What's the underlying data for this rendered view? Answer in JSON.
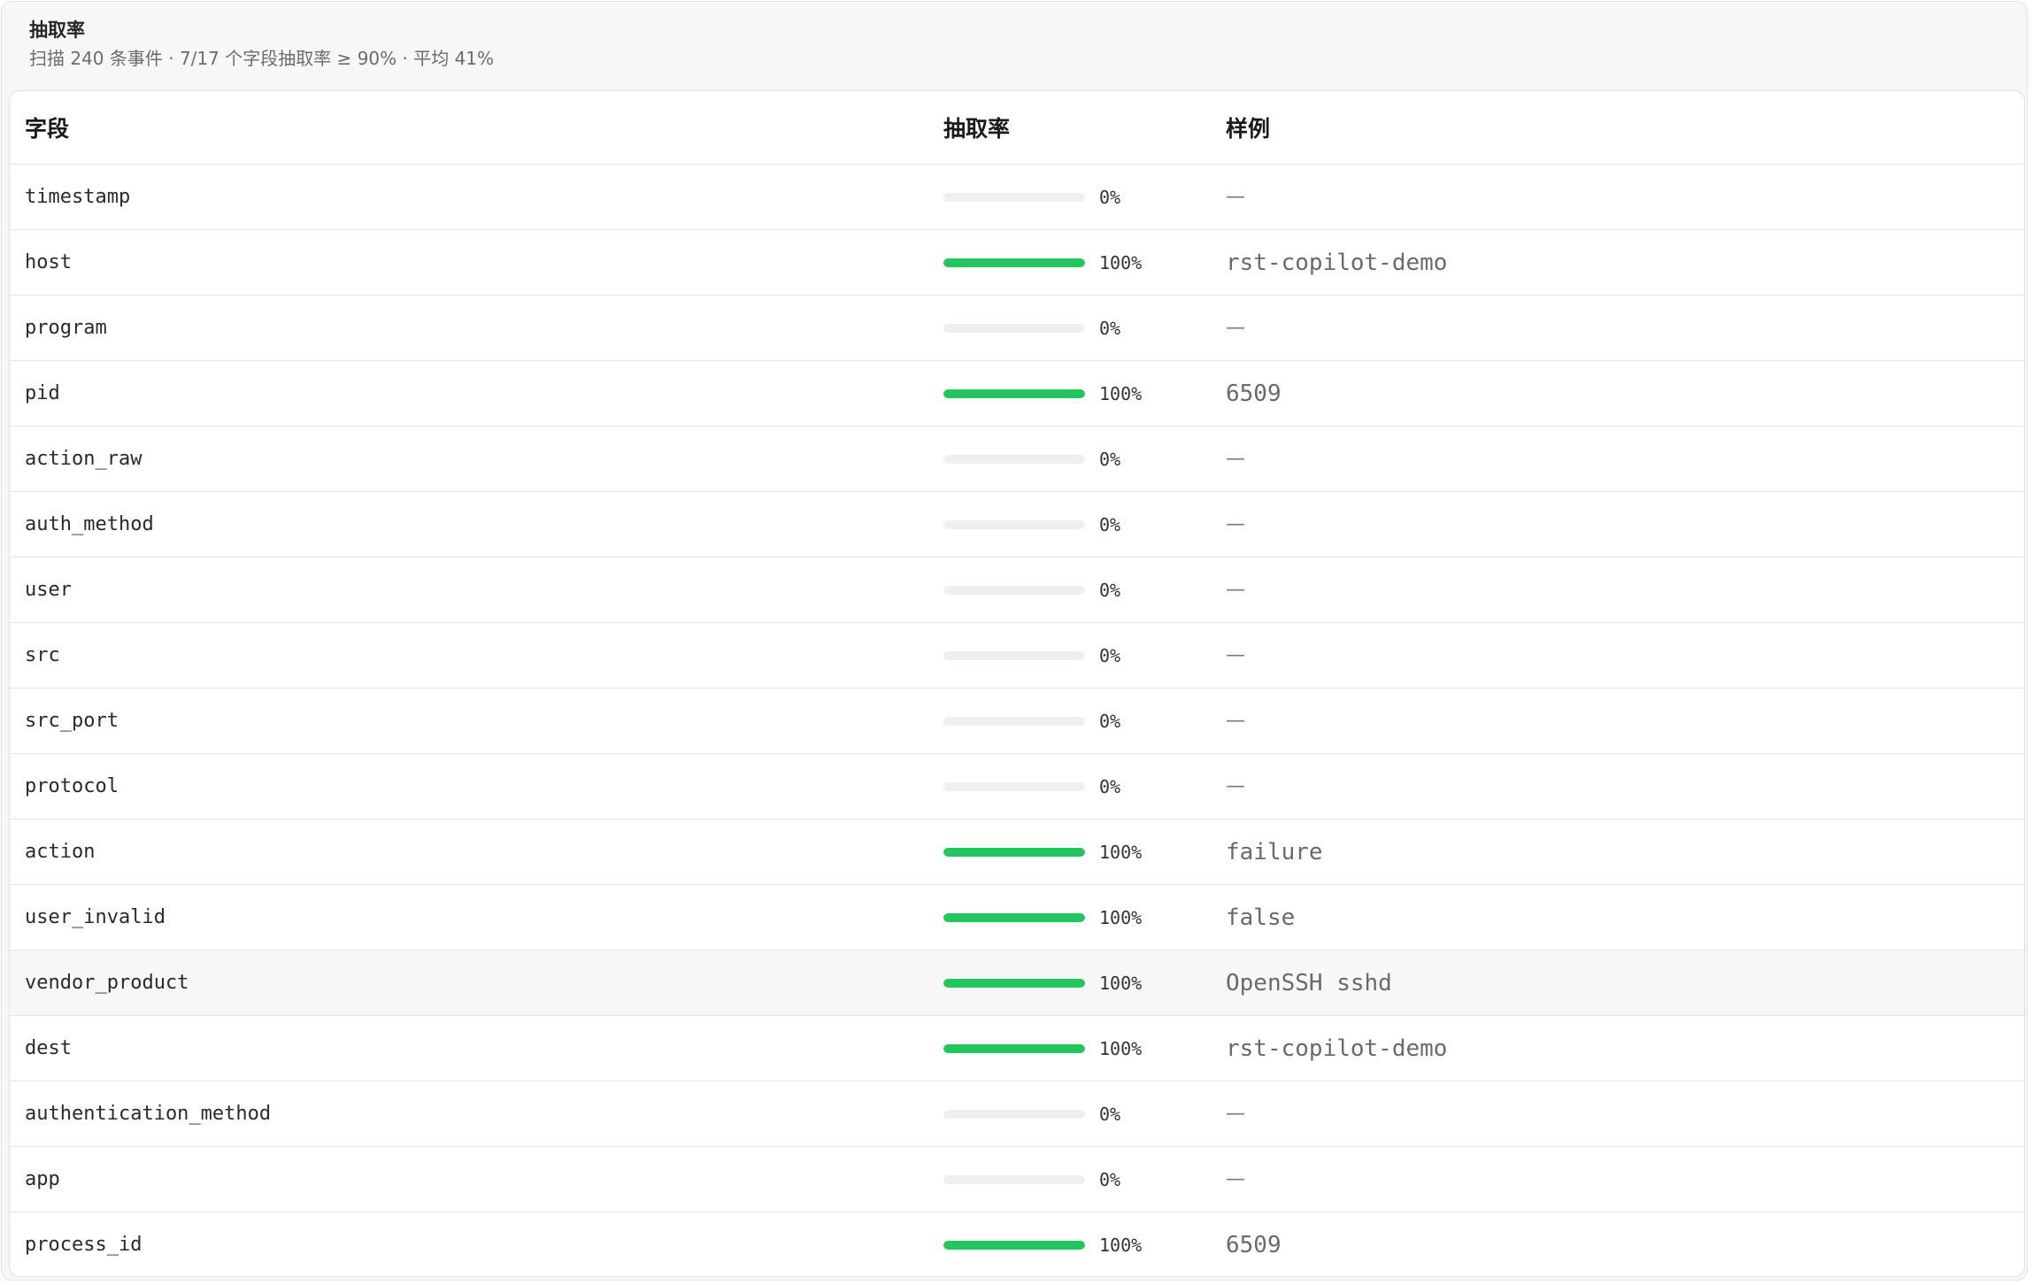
{
  "panel": {
    "title": "抽取率",
    "subtitle": "扫描 240 条事件 · 7/17 个字段抽取率 ≥ 90% · 平均 41%"
  },
  "table": {
    "headers": {
      "field": "字段",
      "rate": "抽取率",
      "sample": "样例"
    },
    "rows": [
      {
        "field": "timestamp",
        "rate": 0,
        "rate_label": "0%",
        "sample": "—"
      },
      {
        "field": "host",
        "rate": 100,
        "rate_label": "100%",
        "sample": "rst-copilot-demo"
      },
      {
        "field": "program",
        "rate": 0,
        "rate_label": "0%",
        "sample": "—"
      },
      {
        "field": "pid",
        "rate": 100,
        "rate_label": "100%",
        "sample": "6509"
      },
      {
        "field": "action_raw",
        "rate": 0,
        "rate_label": "0%",
        "sample": "—"
      },
      {
        "field": "auth_method",
        "rate": 0,
        "rate_label": "0%",
        "sample": "—"
      },
      {
        "field": "user",
        "rate": 0,
        "rate_label": "0%",
        "sample": "—"
      },
      {
        "field": "src",
        "rate": 0,
        "rate_label": "0%",
        "sample": "—"
      },
      {
        "field": "src_port",
        "rate": 0,
        "rate_label": "0%",
        "sample": "—"
      },
      {
        "field": "protocol",
        "rate": 0,
        "rate_label": "0%",
        "sample": "—"
      },
      {
        "field": "action",
        "rate": 100,
        "rate_label": "100%",
        "sample": "failure"
      },
      {
        "field": "user_invalid",
        "rate": 100,
        "rate_label": "100%",
        "sample": "false"
      },
      {
        "field": "vendor_product",
        "rate": 100,
        "rate_label": "100%",
        "sample": "OpenSSH sshd",
        "hovered": true
      },
      {
        "field": "dest",
        "rate": 100,
        "rate_label": "100%",
        "sample": "rst-copilot-demo"
      },
      {
        "field": "authentication_method",
        "rate": 0,
        "rate_label": "0%",
        "sample": "—"
      },
      {
        "field": "app",
        "rate": 0,
        "rate_label": "0%",
        "sample": "—"
      },
      {
        "field": "process_id",
        "rate": 100,
        "rate_label": "100%",
        "sample": "6509"
      }
    ]
  },
  "colors": {
    "bar_fill": "#22c55e",
    "bar_track": "#efefef"
  }
}
